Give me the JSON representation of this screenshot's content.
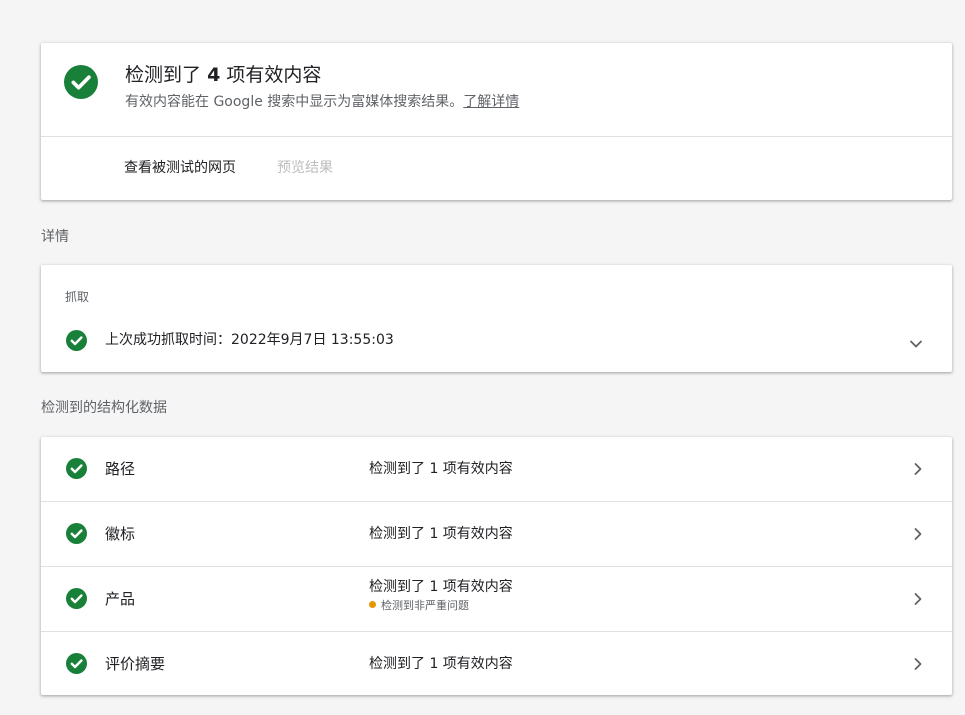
{
  "colors": {
    "success_green": "#188038",
    "warning_orange": "#e69500",
    "text_primary": "#202124",
    "text_secondary": "#5f6368",
    "text_disabled": "#bdbdbd",
    "background": "#f5f5f5"
  },
  "summary": {
    "icon": "check-circle-icon",
    "title_prefix": "检测到了",
    "title_count": "4",
    "title_suffix": "项有效内容",
    "subtitle": "有效内容能在 Google 搜索中显示为富媒体搜索结果。",
    "learn_more": "了解详情",
    "tabs": [
      {
        "label": "查看被测试的网页",
        "enabled": true
      },
      {
        "label": "预览结果",
        "enabled": false
      }
    ]
  },
  "details": {
    "header": "详情",
    "crawl": {
      "label": "抓取",
      "icon": "check-circle-icon",
      "text": "上次成功抓取时间：2022年9月7日 13:55:03",
      "expand_icon": "chevron-down-icon"
    }
  },
  "structured_data": {
    "header": "检测到的结构化数据",
    "items": [
      {
        "name": "路径",
        "status": "检测到了 1 项有效内容",
        "issue": ""
      },
      {
        "name": "徽标",
        "status": "检测到了 1 项有效内容",
        "issue": ""
      },
      {
        "name": "产品",
        "status": "检测到了 1 项有效内容",
        "issue": "检测到非严重问题"
      },
      {
        "name": "评价摘要",
        "status": "检测到了 1 项有效内容",
        "issue": ""
      }
    ]
  }
}
